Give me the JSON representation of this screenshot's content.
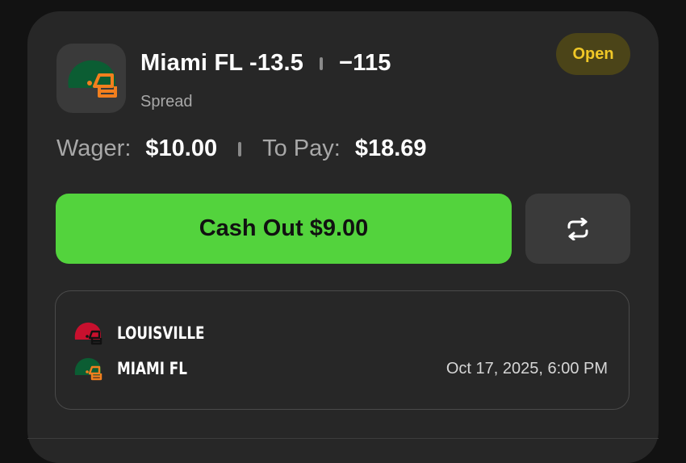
{
  "bet": {
    "selection": "Miami FL -13.5",
    "odds": "−115",
    "market": "Spread",
    "status": "Open"
  },
  "wager": {
    "wager_label": "Wager:",
    "wager_value": "$10.00",
    "to_pay_label": "To Pay:",
    "to_pay_value": "$18.69"
  },
  "actions": {
    "cashout_label": "Cash Out $9.00",
    "swap_icon": "repeat-arrows-icon"
  },
  "game": {
    "teams": [
      {
        "name": "LOUISVILLE",
        "icon": "red-helmet-icon"
      },
      {
        "name": "MIAMI FL",
        "icon": "green-helmet-icon"
      }
    ],
    "datetime": "Oct 17, 2025, 6:00 PM"
  },
  "colors": {
    "background": "#121212",
    "card": "#272727",
    "cashout_green": "#53d33d",
    "badge_bg": "#4b4418",
    "badge_text": "#f0c827",
    "miami_green": "#0b5d33",
    "miami_orange": "#f27f1e",
    "louisville_red": "#c8102e"
  }
}
